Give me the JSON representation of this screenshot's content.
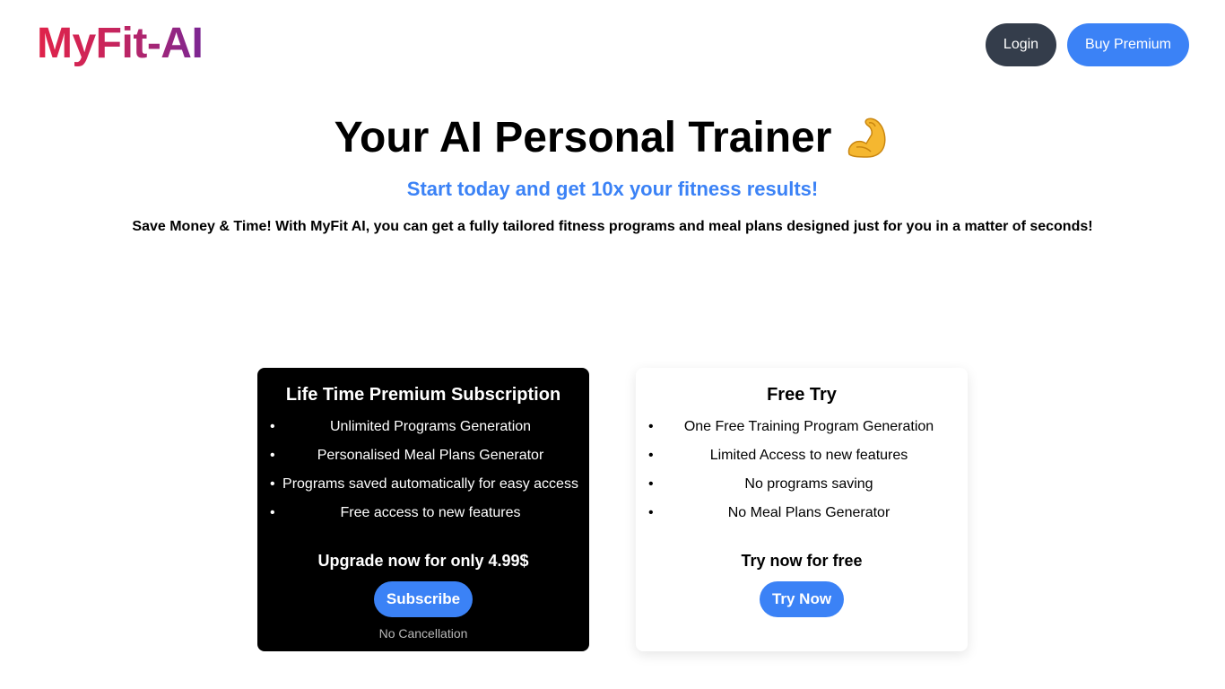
{
  "header": {
    "logo": "MyFit-AI",
    "login_label": "Login",
    "premium_label": "Buy Premium"
  },
  "hero": {
    "title": "Your AI Personal Trainer",
    "title_icon": "flexed-biceps-icon",
    "subtitle": "Start today and get 10x your fitness results!",
    "description": "Save Money & Time! With MyFit AI, you can get a fully tailored fitness programs and meal plans designed just for you in a matter of seconds!"
  },
  "plans": {
    "premium": {
      "title": "Life Time Premium Subscription",
      "features": [
        "Unlimited Programs Generation",
        "Personalised Meal Plans Generator",
        "Programs saved automatically for easy access",
        "Free access to new features"
      ],
      "cta": "Upgrade now for only 4.99$",
      "button_label": "Subscribe",
      "note": "No Cancellation"
    },
    "free": {
      "title": "Free Try",
      "features": [
        "One Free Training Program Generation",
        "Limited Access to new features",
        "No programs saving",
        "No Meal Plans Generator"
      ],
      "cta": "Try now for free",
      "button_label": "Try Now"
    }
  },
  "colors": {
    "accent": "#3b82f6",
    "login_bg": "#343d4b",
    "logo_gradient_start": "#e0234a",
    "logo_gradient_end": "#7b2694"
  }
}
